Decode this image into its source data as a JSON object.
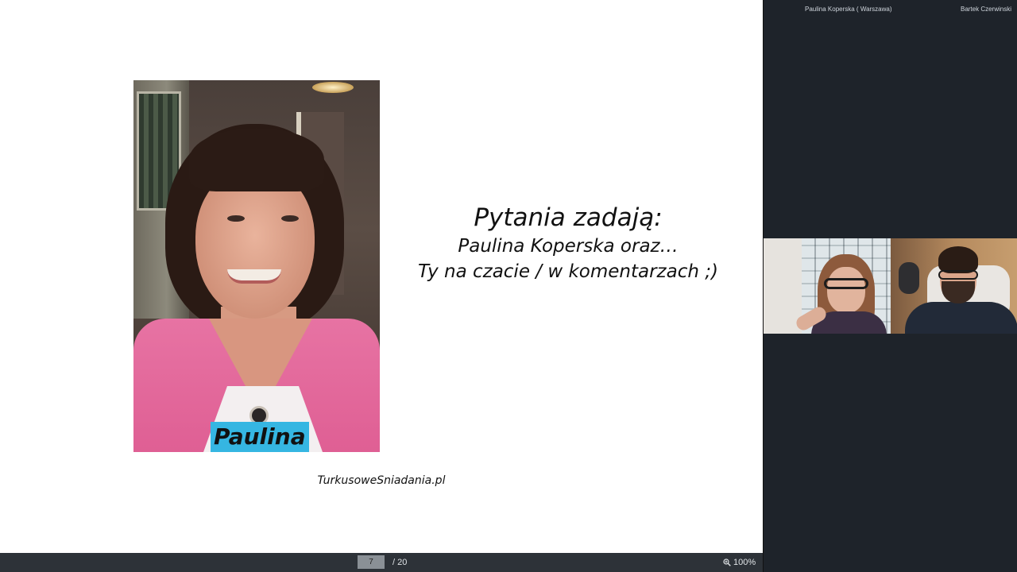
{
  "slide": {
    "name_tag": "Paulina",
    "heading": "Pytania zadają:",
    "lines": [
      "Paulina Koperska oraz…",
      "Ty na czacie / w komentarzach ;)"
    ],
    "footer": "TurkusoweSniadania.pl"
  },
  "toolbar": {
    "current_page": "7",
    "total_pages": "/ 20",
    "zoom_level": "100%",
    "zoom_icon": "zoom-in-icon"
  },
  "video_panel": {
    "participants": [
      {
        "label": "Paulina Koperska ( Warszawa)"
      },
      {
        "label": "Bartek Czerwinski"
      }
    ]
  },
  "colors": {
    "name_tag_bg": "#35b6e2",
    "panel_bg": "#1e232a",
    "toolbar_bg": "#2d3238",
    "blouse": "#e773a3"
  }
}
